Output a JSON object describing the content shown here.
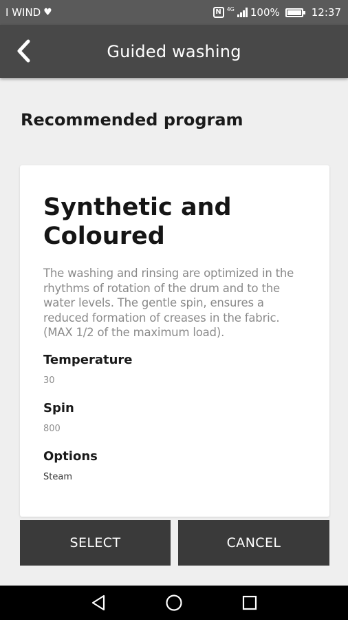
{
  "status_bar": {
    "carrier": "I WIND",
    "nfc_label": "N",
    "network_type": "4G",
    "battery_percent": "100%",
    "time": "12:37",
    "battery_level": 1.0
  },
  "app_bar": {
    "title": "Guided washing",
    "back_icon": "chevron-left-icon"
  },
  "page": {
    "section_title": "Recommended program"
  },
  "program": {
    "name": "Synthetic and Coloured",
    "description": "The washing and rinsing are optimized in the rhythms of rotation of the drum and to the water levels. The gentle spin, ensures a reduced formation of creases in the fabric. (MAX 1/2 of the maximum load).",
    "temperature_label": "Temperature",
    "temperature_value": "30",
    "spin_label": "Spin",
    "spin_value": "800",
    "options_label": "Options",
    "options_value": "Steam"
  },
  "actions": {
    "select_label": "SELECT",
    "cancel_label": "CANCEL"
  },
  "nav_bar": {
    "back_icon": "triangle-back-icon",
    "home_icon": "circle-home-icon",
    "recents_icon": "square-recents-icon"
  },
  "colors": {
    "status_bar": "#5a5a5a",
    "app_bar": "#484848",
    "background": "#efefef",
    "card": "#ffffff",
    "button": "#3a3a3a",
    "nav_bar": "#000000"
  }
}
